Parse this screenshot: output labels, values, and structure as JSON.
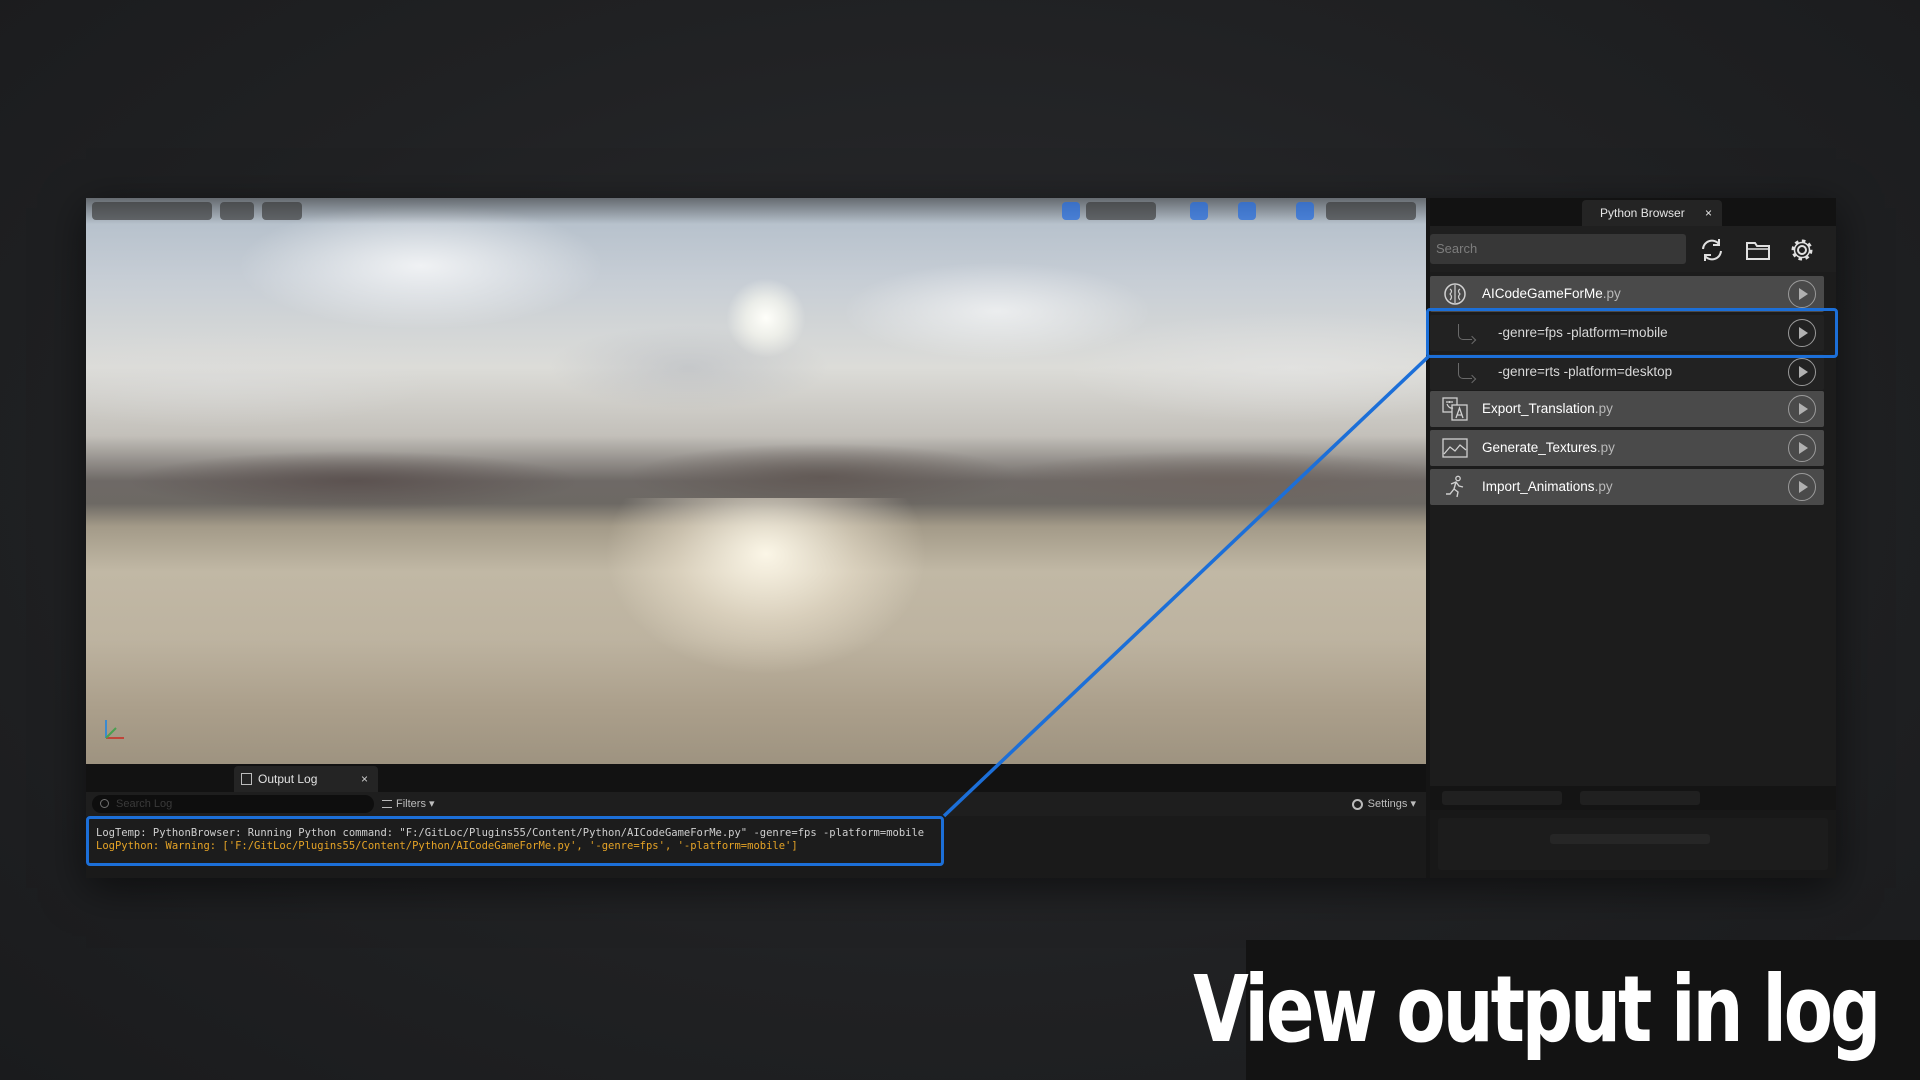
{
  "output_log": {
    "tab_label": "Output Log",
    "tab_close": "×",
    "search_placeholder": "Search Log",
    "filters_label": "Filters",
    "settings_label": "Settings",
    "lines": [
      {
        "level": "normal",
        "text": "LogTemp: PythonBrowser: Running Python command: \"F:/GitLoc/Plugins55/Content/Python/AICodeGameForMe.py\" -genre=fps -platform=mobile"
      },
      {
        "level": "warning",
        "text": "LogPython: Warning: ['F:/GitLoc/Plugins55/Content/Python/AICodeGameForMe.py', '-genre=fps', '-platform=mobile']"
      }
    ]
  },
  "python_browser": {
    "tab_label": "Python Browser",
    "tab_close": "×",
    "search_placeholder": "Search",
    "toolbar_icons": [
      "refresh-icon",
      "folder-icon",
      "gear-icon"
    ],
    "scripts": [
      {
        "kind": "script",
        "name": "AICodeGameForMe",
        "ext": ".py",
        "icon": "brain-icon"
      },
      {
        "kind": "arg",
        "name": "-genre=fps -platform=mobile",
        "highlighted": true
      },
      {
        "kind": "arg",
        "name": "-genre=rts -platform=desktop"
      },
      {
        "kind": "script",
        "name": "Export_Translation",
        "ext": ".py",
        "icon": "translate-icon"
      },
      {
        "kind": "script",
        "name": "Generate_Textures",
        "ext": ".py",
        "icon": "image-icon"
      },
      {
        "kind": "script",
        "name": "Import_Animations",
        "ext": ".py",
        "icon": "running-figure-icon"
      }
    ]
  },
  "caption": "View output in log",
  "colors": {
    "highlight": "#1c6fd8",
    "warning_text": "#e5a326",
    "row_bg": "#4a4a4a"
  }
}
